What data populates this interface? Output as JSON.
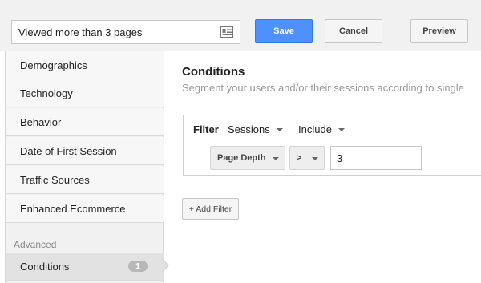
{
  "segment": {
    "name_value": "Viewed more than 3 pages",
    "icon": "contact-card-icon"
  },
  "toolbar": {
    "save_label": "Save",
    "cancel_label": "Cancel",
    "preview_label": "Preview"
  },
  "sidebar": {
    "items": [
      {
        "label": "Demographics"
      },
      {
        "label": "Technology"
      },
      {
        "label": "Behavior"
      },
      {
        "label": "Date of First Session"
      },
      {
        "label": "Traffic Sources"
      },
      {
        "label": "Enhanced Ecommerce"
      }
    ],
    "section_label": "Advanced",
    "advanced_items": [
      {
        "label": "Conditions",
        "badge": "1",
        "active": true
      }
    ]
  },
  "main": {
    "title": "Conditions",
    "subtitle": "Segment your users and/or their sessions according to single"
  },
  "filter": {
    "label": "Filter",
    "scope": "Sessions",
    "mode": "Include",
    "dimension": "Page Depth",
    "operator": ">",
    "value": "3"
  },
  "add_filter_label": "+ Add Filter",
  "colors": {
    "save_button": "#4d90fe",
    "sidebar_bg": "#f1f1f1",
    "badge_bg": "#b8b8b8"
  }
}
